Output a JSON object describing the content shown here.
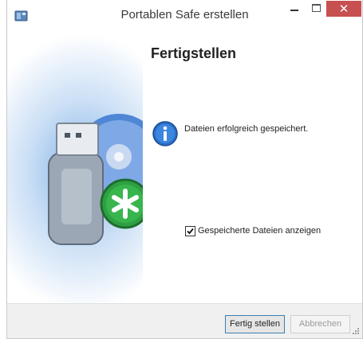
{
  "window": {
    "title": "Portablen Safe erstellen",
    "close_glyph": "✕"
  },
  "page": {
    "heading": "Fertigstellen",
    "info_message": "Dateien erfolgreich gespeichert.",
    "checkbox": {
      "label": "Gespeicherte Dateien anzeigen",
      "checked": true
    }
  },
  "buttons": {
    "finish": "Fertig stellen",
    "cancel": "Abbrechen",
    "cancel_enabled": false
  },
  "icons": {
    "app": "safe-app-icon",
    "info": "info-icon",
    "art": "usb-disc-wizard-illustration"
  },
  "colors": {
    "close_button": "#c75050",
    "default_button_border": "#3c7fb1",
    "info_icon": "#2a6fc9",
    "asterisk_badge": "#2ea043"
  }
}
